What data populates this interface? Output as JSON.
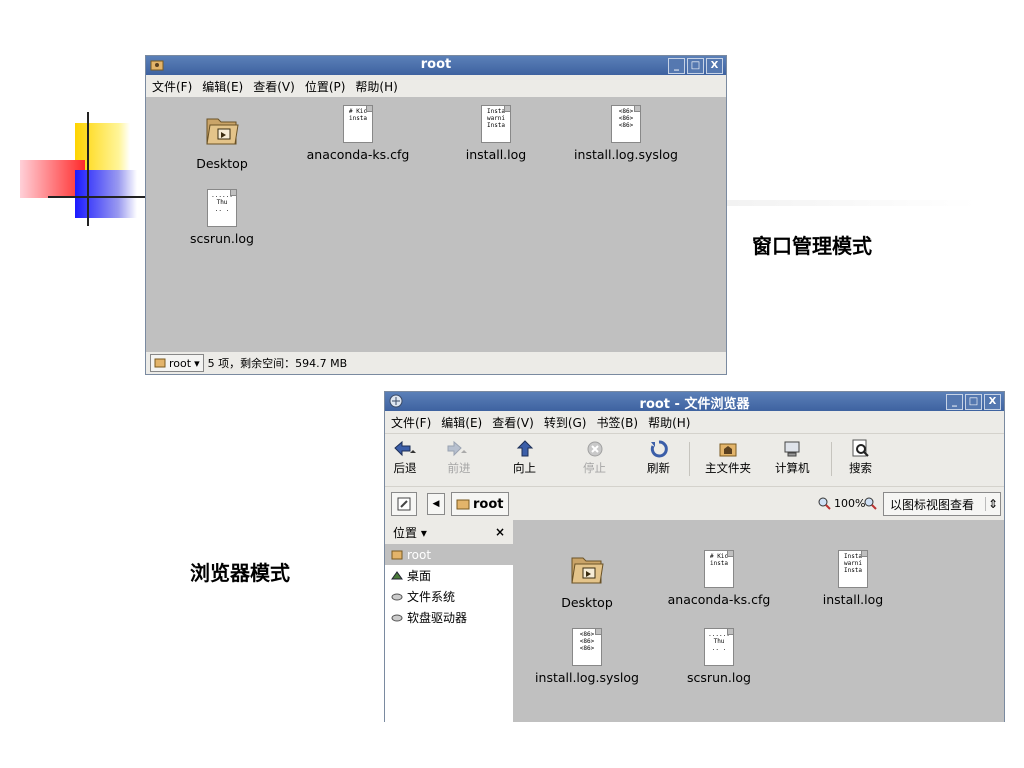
{
  "captions": {
    "window_mode": "窗口管理模式",
    "browser_mode": "浏览器模式"
  },
  "window1": {
    "title": "root",
    "menu": [
      "文件(F)",
      "编辑(E)",
      "查看(V)",
      "位置(P)",
      "帮助(H)"
    ],
    "items": [
      {
        "label": "Desktop",
        "icon": "folder-icon"
      },
      {
        "label": "anaconda-ks.cfg",
        "icon": "text-file-icon",
        "preview": [
          "# Kic",
          "",
          "insta"
        ]
      },
      {
        "label": "install.log",
        "icon": "text-file-icon",
        "preview": [
          "Insta",
          "warni",
          "Insta"
        ]
      },
      {
        "label": "install.log.syslog",
        "icon": "text-file-icon",
        "preview": [
          "<86>",
          "<86>",
          "<86>"
        ]
      },
      {
        "label": "scsrun.log",
        "icon": "text-file-icon",
        "preview": [
          "......",
          "Thu",
          "..  ."
        ]
      }
    ],
    "status_location": "root",
    "status_text": "5 项，剩余空间：594.7 MB"
  },
  "window2": {
    "title": "root - 文件浏览器",
    "menu": [
      "文件(F)",
      "编辑(E)",
      "查看(V)",
      "转到(G)",
      "书签(B)",
      "帮助(H)"
    ],
    "toolbar": {
      "back": "后退",
      "forward": "前进",
      "up": "向上",
      "stop": "停止",
      "reload": "刷新",
      "home": "主文件夹",
      "computer": "计算机",
      "search": "搜索"
    },
    "location": "root",
    "zoom": "100%",
    "view_mode": "以图标视图查看",
    "sidebar": {
      "header": "位置",
      "close": "×",
      "items": [
        "root",
        "桌面",
        "文件系统",
        "软盘驱动器"
      ]
    },
    "items": [
      {
        "label": "Desktop",
        "icon": "folder-icon"
      },
      {
        "label": "anaconda-ks.cfg",
        "icon": "text-file-icon",
        "preview": [
          "# Kic",
          "",
          "insta"
        ]
      },
      {
        "label": "install.log",
        "icon": "text-file-icon",
        "preview": [
          "Insta",
          "warni",
          "Insta"
        ]
      },
      {
        "label": "install.log.syslog",
        "icon": "text-file-icon",
        "preview": [
          "<86>",
          "<86>",
          "<86>"
        ]
      },
      {
        "label": "scsrun.log",
        "icon": "text-file-icon",
        "preview": [
          "......",
          "Thu",
          "..  ."
        ]
      }
    ]
  }
}
